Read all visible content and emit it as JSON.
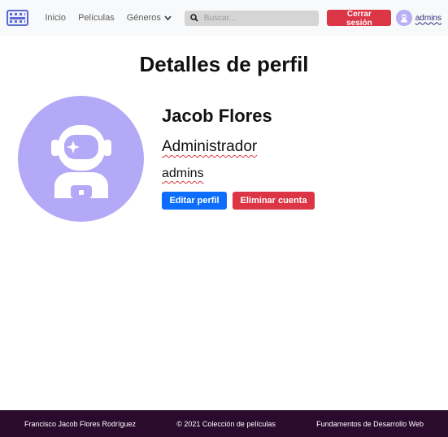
{
  "nav": {
    "links": [
      "Inicio",
      "Películas"
    ],
    "dropdown_label": "Géneros",
    "search_placeholder": "Buscar...",
    "logout_label": "Cerrar sesión",
    "username": "admins"
  },
  "page": {
    "title": "Detalles de perfil"
  },
  "profile": {
    "name": "Jacob Flores",
    "role": "Administrador",
    "username": "admins",
    "edit_label": "Editar perfil",
    "delete_label": "Eliminar cuenta"
  },
  "footer": {
    "author": "Francisco Jacob Flores Rodríguez",
    "copyright": "© 2021 Colección de películas",
    "course": "Fundamentos de Desarrollo Web"
  },
  "colors": {
    "navbar_bg": "#f8f9fa",
    "avatar_bg": "#b3a9f7",
    "primary": "#0d6efd",
    "danger": "#dc3545",
    "footer_bg": "#2a0a2d"
  },
  "icons": {
    "logo": "film-strip-icon",
    "search": "search-icon",
    "dropdown": "chevron-down-icon",
    "avatar": "astronaut-icon"
  }
}
